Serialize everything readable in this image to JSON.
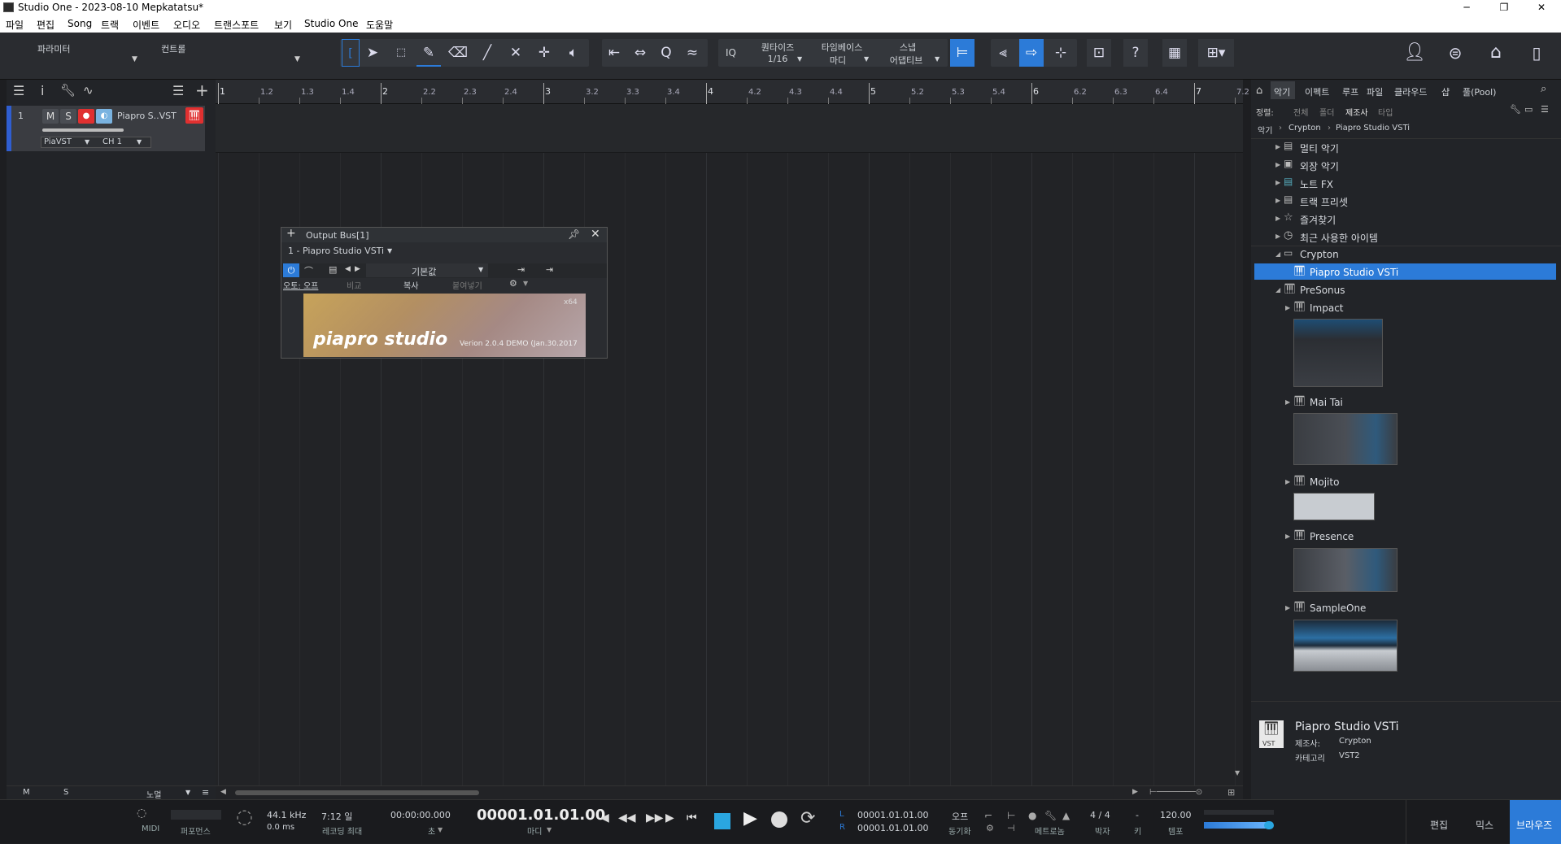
{
  "window": {
    "title": "Studio One - 2023-08-10 Mepkatatsu*",
    "min": "─",
    "max": "❐",
    "close": "✕"
  },
  "menu": [
    "파일",
    "편집",
    "Song",
    "트랙",
    "이벤트",
    "오디오",
    "트랜스포트",
    "보기",
    "Studio One",
    "도움말"
  ],
  "toolbar": {
    "param_label": "파라미터",
    "control_label": "컨트롤",
    "iq": "IQ",
    "quantize_label": "퀀타이즈",
    "quantize_value": "1/16",
    "timebase_label": "타임베이스",
    "timebase_value": "마디",
    "snap_label": "스냅",
    "snap_value": "어댑티브",
    "help": "?"
  },
  "track": {
    "number": "1",
    "mute": "M",
    "solo": "S",
    "name": "Piapro S..VST",
    "instrument": "PiaVST",
    "channel": "CH 1"
  },
  "left_footer": {
    "m": "M",
    "s": "S",
    "mode": "노멀"
  },
  "ruler": [
    {
      "label": "1",
      "major": true
    },
    {
      "label": "1.2"
    },
    {
      "label": "1.3"
    },
    {
      "label": "1.4"
    },
    {
      "label": "2",
      "major": true
    },
    {
      "label": "2.2"
    },
    {
      "label": "2.3"
    },
    {
      "label": "2.4"
    },
    {
      "label": "3",
      "major": true
    },
    {
      "label": "3.2"
    },
    {
      "label": "3.3"
    },
    {
      "label": "3.4"
    },
    {
      "label": "4",
      "major": true
    },
    {
      "label": "4.2"
    },
    {
      "label": "4.3"
    },
    {
      "label": "4.4"
    },
    {
      "label": "5",
      "major": true
    },
    {
      "label": "5.2"
    },
    {
      "label": "5.3"
    },
    {
      "label": "5.4"
    },
    {
      "label": "6",
      "major": true
    },
    {
      "label": "6.2"
    },
    {
      "label": "6.3"
    },
    {
      "label": "6.4"
    },
    {
      "label": "7",
      "major": true
    },
    {
      "label": "7.2"
    }
  ],
  "plugin": {
    "title": "Output Bus[1]",
    "instance": "1 - Piapro Studio VSTi",
    "preset": "기본값",
    "auto_off": "오토: 오프",
    "compare": "비교",
    "copy": "복사",
    "paste": "붙여넣기",
    "x64": "x64",
    "logo": "piapro studio",
    "version": "Verion 2.0.4 DEMO (Jan.30.2017"
  },
  "browser": {
    "tabs": [
      "악기",
      "이펙트",
      "루프",
      "파일",
      "클라우드",
      "샵",
      "풀(Pool)"
    ],
    "sort_label": "정렬:",
    "sort_options": [
      "전체",
      "폴더",
      "제조사",
      "타입"
    ],
    "breadcrumb": [
      "악기",
      "Crypton",
      "Piapro Studio VSTi"
    ],
    "tree": {
      "multi": "멀티 악기",
      "external": "외장 악기",
      "notefx": "노트 FX",
      "trackpreset": "트랙 프리셋",
      "favorites": "즐겨찾기",
      "recent": "최근 사용한 아이템",
      "crypton": "Crypton",
      "piapro": "Piapro Studio VSTi",
      "presonus": "PreSonus",
      "impact": "Impact",
      "maitai": "Mai Tai",
      "mojito": "Mojito",
      "presence": "Presence",
      "sampleone": "SampleOne"
    },
    "info": {
      "name": "Piapro Studio VSTi",
      "maker_label": "제조사:",
      "maker": "Crypton",
      "cat_label": "카테고리",
      "cat": "VST2",
      "badge": "VST"
    }
  },
  "transport": {
    "midi": "MIDI",
    "perf": "퍼포먼스",
    "sample_rate": "44.1 kHz",
    "latency": "0.0 ms",
    "rec_time": "7:12 일",
    "rec_label": "레코딩 최대",
    "time_sec": "00:00:00.000",
    "time_sec_label": "초",
    "position": "00001.01.01.00",
    "position_label": "마디",
    "loop_l": "L",
    "loop_r": "R",
    "loop_start": "00001.01.01.00",
    "loop_end": "00001.01.01.00",
    "sync": "오프",
    "sync_label": "동기화",
    "metronome_label": "메트로놈",
    "signature": "4 / 4",
    "signature_label": "박자",
    "key": "-",
    "key_label": "키",
    "tempo": "120.00",
    "tempo_label": "템포",
    "edit": "편집",
    "mix": "믹스",
    "browse": "브라우즈"
  },
  "colors": {
    "accent": "#2c7bd8",
    "record": "#e03030",
    "track_stripe": "#2f5ed1"
  }
}
